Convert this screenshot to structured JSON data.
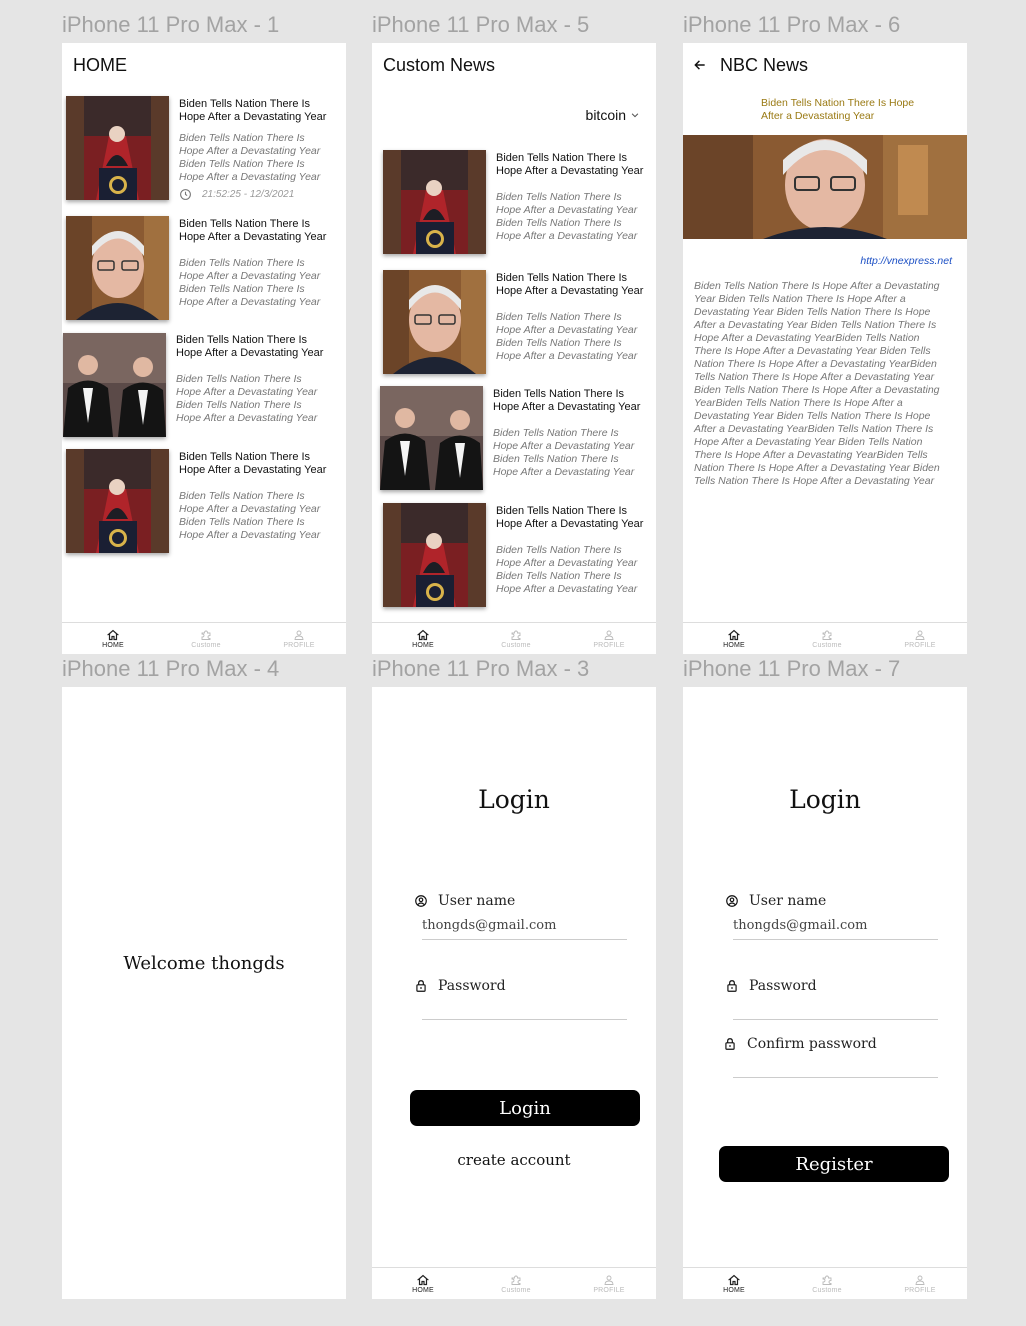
{
  "frames": {
    "f1": "iPhone 11 Pro Max - 1",
    "f5": "iPhone 11 Pro Max - 5",
    "f6": "iPhone 11 Pro Max - 6",
    "f4": "iPhone 11 Pro Max - 4",
    "f3": "iPhone 11 Pro Max - 3",
    "f7": "iPhone 11 Pro Max - 7"
  },
  "nav": {
    "home": "HOME",
    "custom": "Custome",
    "profile": "PROFILE"
  },
  "article": {
    "title": "Biden Tells Nation There Is Hope After a Devastating Year",
    "desc": "Biden Tells Nation There Is Hope After a Devastating Year Biden Tells Nation There Is Hope After a Devastating Year"
  },
  "home": {
    "title": "HOME",
    "time": "21:52:25 - 12/3/2021"
  },
  "custom": {
    "title": "Custom News",
    "filter": "bitcoin"
  },
  "detail": {
    "title": "NBC News",
    "headline": "Biden Tells Nation There Is Hope After a Devastating Year",
    "link": "http://vnexpress.net",
    "body": "Biden Tells Nation There Is Hope After a Devastating Year Biden Tells Nation There Is Hope After a Devastating Year Biden Tells Nation There Is Hope After a Devastating Year Biden Tells Nation There Is Hope After a Devastating YearBiden Tells Nation There Is Hope After a Devastating Year Biden Tells Nation There Is Hope After a Devastating YearBiden Tells Nation There Is Hope After a Devastating Year Biden Tells Nation There Is Hope After a Devastating YearBiden Tells Nation There Is Hope After a Devastating Year Biden Tells Nation There Is Hope After a Devastating YearBiden Tells Nation There Is Hope After a Devastating Year Biden Tells Nation There Is Hope After a Devastating YearBiden Tells Nation There Is Hope After a Devastating Year Biden Tells Nation There Is Hope After a Devastating Year"
  },
  "welcome": "Welcome thongds",
  "login": {
    "heading": "Login",
    "user_label": "User name",
    "user_value": "thongds@gmail.com",
    "password_label": "Password",
    "button": "Login",
    "create": "create account"
  },
  "register": {
    "heading": "Login",
    "user_label": "User name",
    "user_value": "thongds@gmail.com",
    "password_label": "Password",
    "confirm_label": "Confirm password",
    "button": "Register"
  },
  "colors": {
    "headline": "#9a7a14",
    "link": "#1b4fc4",
    "button": "#000000"
  },
  "icons": [
    "home-icon",
    "puzzle-icon",
    "user-icon",
    "clock-icon",
    "chevron-down-icon",
    "arrow-left-icon",
    "account-circle-icon",
    "lock-icon"
  ]
}
